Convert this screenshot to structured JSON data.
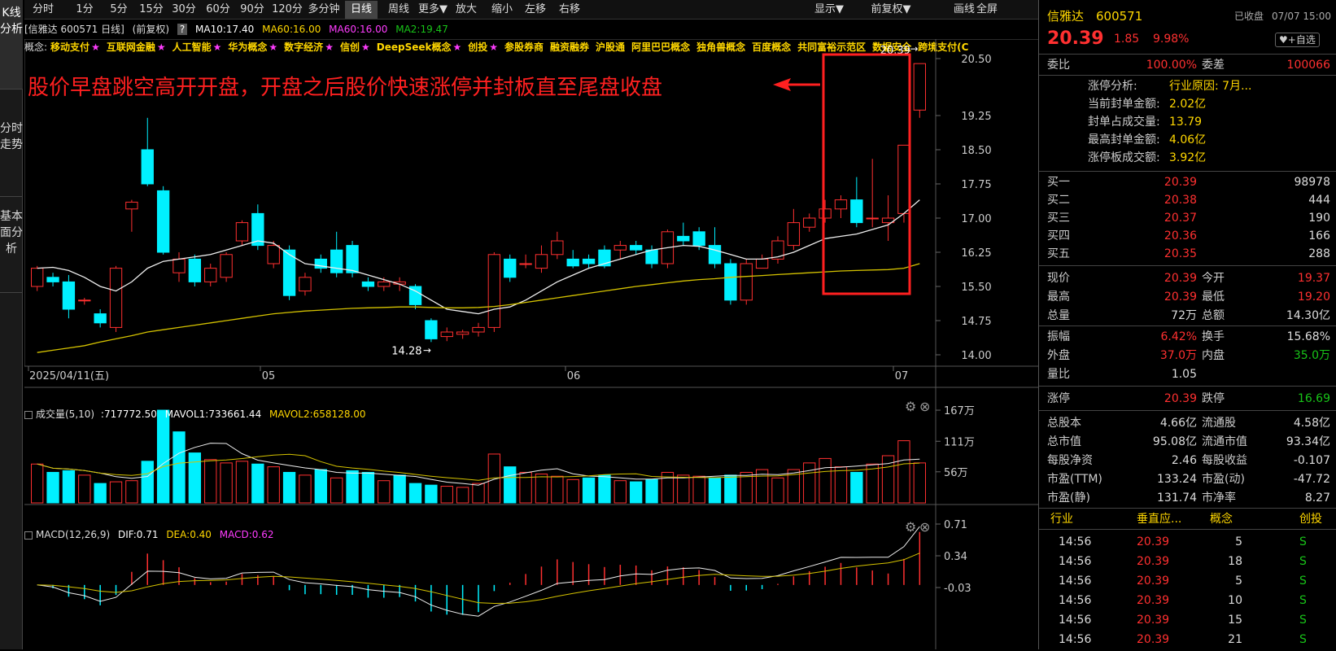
{
  "left_tabs": [
    "K线分析",
    "分时走势",
    "基本面分析"
  ],
  "toolbar": {
    "items": [
      "分时",
      "1分",
      "5分",
      "15分",
      "30分",
      "60分",
      "90分",
      "120分",
      "多分钟",
      "日线",
      "周线",
      "更多▼",
      "放大",
      "缩小",
      "左移",
      "右移",
      "显示▼",
      "前复权▼",
      "画线",
      "全屏"
    ],
    "active": "日线"
  },
  "info": {
    "stock": "[信雅达 600571 日线]",
    "adj": "(前复权)",
    "q": "?",
    "ma10": "MA10:17.40",
    "ma60a": "MA60:16.00",
    "ma60b": "MA60:16.00",
    "ma2": "MA2:19.47"
  },
  "concepts_label": "概念:",
  "concepts": [
    {
      "name": "移动支付",
      "star": true
    },
    {
      "name": "互联网金融",
      "star": true
    },
    {
      "name": "人工智能",
      "star": true
    },
    {
      "name": "华为概念",
      "star": true
    },
    {
      "name": "数字经济",
      "star": true
    },
    {
      "name": "信创",
      "star": true
    },
    {
      "name": "DeepSeek概念",
      "star": true
    },
    {
      "name": "创投",
      "star": true
    },
    {
      "name": "参股券商",
      "star": false
    },
    {
      "name": "融资融券",
      "star": false
    },
    {
      "name": "沪股通",
      "star": false
    },
    {
      "name": "阿里巴巴概念",
      "star": false
    },
    {
      "name": "独角兽概念",
      "star": false
    },
    {
      "name": "百度概念",
      "star": false
    },
    {
      "name": "共同富裕示范区",
      "star": false
    },
    {
      "name": "数据安全",
      "star": false
    },
    {
      "name": "跨境支付(C",
      "star": false
    }
  ],
  "annotation": "股价早盘跳空高开开盘，开盘之后股价快速涨停并封板直至尾盘收盘",
  "chart_data": [
    {
      "type": "candlestick",
      "title": "信雅达 600571 日线",
      "y_ticks": [
        "20.50",
        "19.25",
        "18.50",
        "17.75",
        "17.00",
        "16.25",
        "15.50",
        "14.75",
        "14.00"
      ],
      "x_labels": [
        "2025/04/11(五)",
        "05",
        "06",
        "07"
      ],
      "high_label": "20.39",
      "low_label": "14.28",
      "candles": [
        [
          15.5,
          15.9,
          15.4,
          15.95
        ],
        [
          15.7,
          15.6,
          15.5,
          15.8
        ],
        [
          15.6,
          15.0,
          14.8,
          15.75
        ],
        [
          15.2,
          15.2,
          15.1,
          15.25
        ],
        [
          14.9,
          14.7,
          14.6,
          15.0
        ],
        [
          14.6,
          15.9,
          14.5,
          15.95
        ],
        [
          17.2,
          17.35,
          16.7,
          17.4
        ],
        [
          18.5,
          17.75,
          17.7,
          19.2
        ],
        [
          17.6,
          16.25,
          16.2,
          17.7
        ],
        [
          15.8,
          16.1,
          15.6,
          16.25
        ],
        [
          16.1,
          15.6,
          15.5,
          16.2
        ],
        [
          15.6,
          15.9,
          15.5,
          16.0
        ],
        [
          15.7,
          16.2,
          15.6,
          16.25
        ],
        [
          16.5,
          16.9,
          16.4,
          16.95
        ],
        [
          17.1,
          16.4,
          16.3,
          17.3
        ],
        [
          16.0,
          16.4,
          15.9,
          16.5
        ],
        [
          16.3,
          15.3,
          15.2,
          16.4
        ],
        [
          15.4,
          15.7,
          15.3,
          15.8
        ],
        [
          16.1,
          15.9,
          15.8,
          16.2
        ],
        [
          16.3,
          15.8,
          15.7,
          16.7
        ],
        [
          16.4,
          15.8,
          15.7,
          16.5
        ],
        [
          15.6,
          15.5,
          15.4,
          15.7
        ],
        [
          15.5,
          15.6,
          15.4,
          15.7
        ],
        [
          15.55,
          15.6,
          15.4,
          15.7
        ],
        [
          15.5,
          15.1,
          15.0,
          15.55
        ],
        [
          14.75,
          14.35,
          14.28,
          14.8
        ],
        [
          14.4,
          14.5,
          14.3,
          14.6
        ],
        [
          14.45,
          14.5,
          14.35,
          14.55
        ],
        [
          14.5,
          14.6,
          14.4,
          14.7
        ],
        [
          14.6,
          16.2,
          14.5,
          16.25
        ],
        [
          16.1,
          15.7,
          15.6,
          16.2
        ],
        [
          16.0,
          16.0,
          15.9,
          16.2
        ],
        [
          15.9,
          16.2,
          15.8,
          16.4
        ],
        [
          16.2,
          16.5,
          16.1,
          16.7
        ],
        [
          16.1,
          15.95,
          15.9,
          16.3
        ],
        [
          16.1,
          16.0,
          15.9,
          16.2
        ],
        [
          16.3,
          15.95,
          15.9,
          16.4
        ],
        [
          16.3,
          16.4,
          16.1,
          16.5
        ],
        [
          16.4,
          16.3,
          16.2,
          16.5
        ],
        [
          16.3,
          16.0,
          15.9,
          16.4
        ],
        [
          16.0,
          16.7,
          15.9,
          16.75
        ],
        [
          16.6,
          16.5,
          16.4,
          16.9
        ],
        [
          16.7,
          16.4,
          16.3,
          16.8
        ],
        [
          16.4,
          16.0,
          15.9,
          16.8
        ],
        [
          16.0,
          15.2,
          15.1,
          16.1
        ],
        [
          15.2,
          16.0,
          15.1,
          16.1
        ],
        [
          15.9,
          16.1,
          15.9,
          16.2
        ],
        [
          16.1,
          16.5,
          16.0,
          16.6
        ],
        [
          16.4,
          16.9,
          16.3,
          17.2
        ],
        [
          16.8,
          17.0,
          16.7,
          17.1
        ],
        [
          17.0,
          17.2,
          16.9,
          17.4
        ],
        [
          17.2,
          17.4,
          17.0,
          17.5
        ],
        [
          17.4,
          16.9,
          16.8,
          17.9
        ],
        [
          17.0,
          17.0,
          16.8,
          18.3
        ],
        [
          16.9,
          17.0,
          16.5,
          17.5
        ],
        [
          17.1,
          18.6,
          16.9,
          18.6
        ],
        [
          19.37,
          20.39,
          19.2,
          20.39
        ]
      ],
      "ma_white": [
        15.9,
        15.92,
        15.85,
        15.7,
        15.5,
        15.4,
        15.6,
        15.9,
        16.05,
        16.1,
        16.15,
        16.2,
        16.3,
        16.4,
        16.5,
        16.45,
        16.2,
        16.0,
        15.95,
        15.9,
        15.85,
        15.75,
        15.65,
        15.55,
        15.4,
        15.2,
        15.0,
        14.95,
        14.9,
        15.0,
        15.05,
        15.2,
        15.4,
        15.6,
        15.75,
        15.9,
        16.0,
        16.1,
        16.2,
        16.3,
        16.35,
        16.4,
        16.38,
        16.3,
        16.2,
        16.1,
        16.1,
        16.15,
        16.25,
        16.4,
        16.55,
        16.6,
        16.65,
        16.75,
        16.85,
        17.1,
        17.4
      ],
      "ma_yellow": [
        14.05,
        14.1,
        14.15,
        14.2,
        14.28,
        14.35,
        14.42,
        14.5,
        14.55,
        14.6,
        14.65,
        14.7,
        14.75,
        14.8,
        14.85,
        14.9,
        14.93,
        14.96,
        14.98,
        15.0,
        15.02,
        15.03,
        15.04,
        15.05,
        15.05,
        15.04,
        15.03,
        15.03,
        15.04,
        15.06,
        15.1,
        15.15,
        15.2,
        15.25,
        15.3,
        15.35,
        15.4,
        15.45,
        15.5,
        15.54,
        15.58,
        15.62,
        15.65,
        15.67,
        15.7,
        15.72,
        15.74,
        15.76,
        15.78,
        15.8,
        15.82,
        15.84,
        15.85,
        15.86,
        15.87,
        15.9,
        16.0
      ]
    },
    {
      "type": "bar",
      "title": "成交量(5,10)",
      "y_ticks": [
        "167万",
        "111万",
        "56万"
      ],
      "values": [
        70,
        55,
        58,
        50,
        35,
        38,
        40,
        75,
        167,
        128,
        90,
        78,
        72,
        75,
        70,
        65,
        55,
        50,
        60,
        45,
        58,
        55,
        40,
        50,
        35,
        32,
        30,
        28,
        35,
        88,
        65,
        55,
        52,
        48,
        42,
        45,
        50,
        40,
        38,
        42,
        55,
        50,
        48,
        45,
        50,
        55,
        60,
        45,
        60,
        72,
        80,
        65,
        55,
        70,
        85,
        112,
        72
      ],
      "down": [
        false,
        true,
        true,
        false,
        true,
        false,
        false,
        true,
        true,
        true,
        true,
        false,
        false,
        false,
        true,
        false,
        true,
        false,
        true,
        false,
        true,
        true,
        false,
        true,
        true,
        true,
        false,
        false,
        false,
        false,
        true,
        false,
        false,
        false,
        false,
        true,
        true,
        false,
        true,
        true,
        false,
        false,
        false,
        true,
        true,
        false,
        false,
        false,
        false,
        false,
        false,
        false,
        true,
        false,
        false,
        false,
        false
      ],
      "mavol1": "733661.44",
      "mavol2": "658128.00",
      "volval": "717772.50"
    },
    {
      "type": "bar",
      "title": "MACD(12,26,9)",
      "y_ticks": [
        "0.71",
        "0.34",
        "-0.03"
      ],
      "dif": "0.71",
      "dea": "0.40",
      "macd": "0.62"
    }
  ],
  "right": {
    "name": "信雅达",
    "code": "600571",
    "status": "已收盘",
    "date": "07/07 15:00",
    "price": "20.39",
    "change": "1.85",
    "pct": "9.98%",
    "add_btn": "+自选",
    "webi_lbl": "委比",
    "webi": "100.00%",
    "wecha_lbl": "委差",
    "wecha": "100066",
    "zt": [
      {
        "k": "涨停分析:",
        "v": "行业原因: 7月..."
      },
      {
        "k": "当前封单金额:",
        "v": "2.02亿"
      },
      {
        "k": "封单占成交量:",
        "v": "13.79"
      },
      {
        "k": "最高封单金额:",
        "v": "4.06亿"
      },
      {
        "k": "涨停板成交额:",
        "v": "3.92亿"
      }
    ],
    "buys": [
      {
        "k": "买一",
        "p": "20.39",
        "v": "98978"
      },
      {
        "k": "买二",
        "p": "20.38",
        "v": "444"
      },
      {
        "k": "买三",
        "p": "20.37",
        "v": "190"
      },
      {
        "k": "买四",
        "p": "20.36",
        "v": "166"
      },
      {
        "k": "买五",
        "p": "20.35",
        "v": "288"
      }
    ],
    "quote": [
      [
        {
          "k": "现价",
          "v": "20.39",
          "c": "red"
        },
        {
          "k": "今开",
          "v": "19.37",
          "c": "red"
        }
      ],
      [
        {
          "k": "最高",
          "v": "20.39",
          "c": "red"
        },
        {
          "k": "最低",
          "v": "19.20",
          "c": "red"
        }
      ],
      [
        {
          "k": "总量",
          "v": "72万",
          "c": "white"
        },
        {
          "k": "总额",
          "v": "14.30亿",
          "c": "white"
        }
      ]
    ],
    "quote2": [
      [
        {
          "k": "振幅",
          "v": "6.42%",
          "c": "red"
        },
        {
          "k": "换手",
          "v": "15.68%",
          "c": "white"
        }
      ],
      [
        {
          "k": "外盘",
          "v": "37.0万",
          "c": "red"
        },
        {
          "k": "内盘",
          "v": "35.0万",
          "c": "green"
        }
      ],
      [
        {
          "k": "量比",
          "v": "1.05",
          "c": "white"
        },
        {
          "k": "",
          "v": "",
          "c": "white"
        }
      ]
    ],
    "limit": [
      {
        "k": "涨停",
        "v": "20.39",
        "c": "red"
      },
      {
        "k": "跌停",
        "v": "16.69",
        "c": "green"
      }
    ],
    "fund": [
      [
        {
          "k": "总股本",
          "v": "4.66亿"
        },
        {
          "k": "流通股",
          "v": "4.58亿"
        }
      ],
      [
        {
          "k": "总市值",
          "v": "95.08亿"
        },
        {
          "k": "流通市值",
          "v": "93.34亿"
        }
      ],
      [
        {
          "k": "每股净资",
          "v": "2.46"
        },
        {
          "k": "每股收益",
          "v": "-0.107"
        }
      ],
      [
        {
          "k": "市盈(TTM)",
          "v": "133.24"
        },
        {
          "k": "市盈(动)",
          "v": "-47.72"
        }
      ],
      [
        {
          "k": "市盈(静)",
          "v": "131.74"
        },
        {
          "k": "市净率",
          "v": "8.27"
        }
      ]
    ],
    "tabs": [
      "行业",
      "垂直应...",
      "概念",
      "创投"
    ],
    "ticks": [
      {
        "t": "14:56",
        "p": "20.39",
        "v": "5",
        "s": "S"
      },
      {
        "t": "14:56",
        "p": "20.39",
        "v": "18",
        "s": "S"
      },
      {
        "t": "14:56",
        "p": "20.39",
        "v": "5",
        "s": "S"
      },
      {
        "t": "14:56",
        "p": "20.39",
        "v": "10",
        "s": "S"
      },
      {
        "t": "14:56",
        "p": "20.39",
        "v": "15",
        "s": "S"
      },
      {
        "t": "14:56",
        "p": "20.39",
        "v": "21",
        "s": "S"
      }
    ]
  }
}
